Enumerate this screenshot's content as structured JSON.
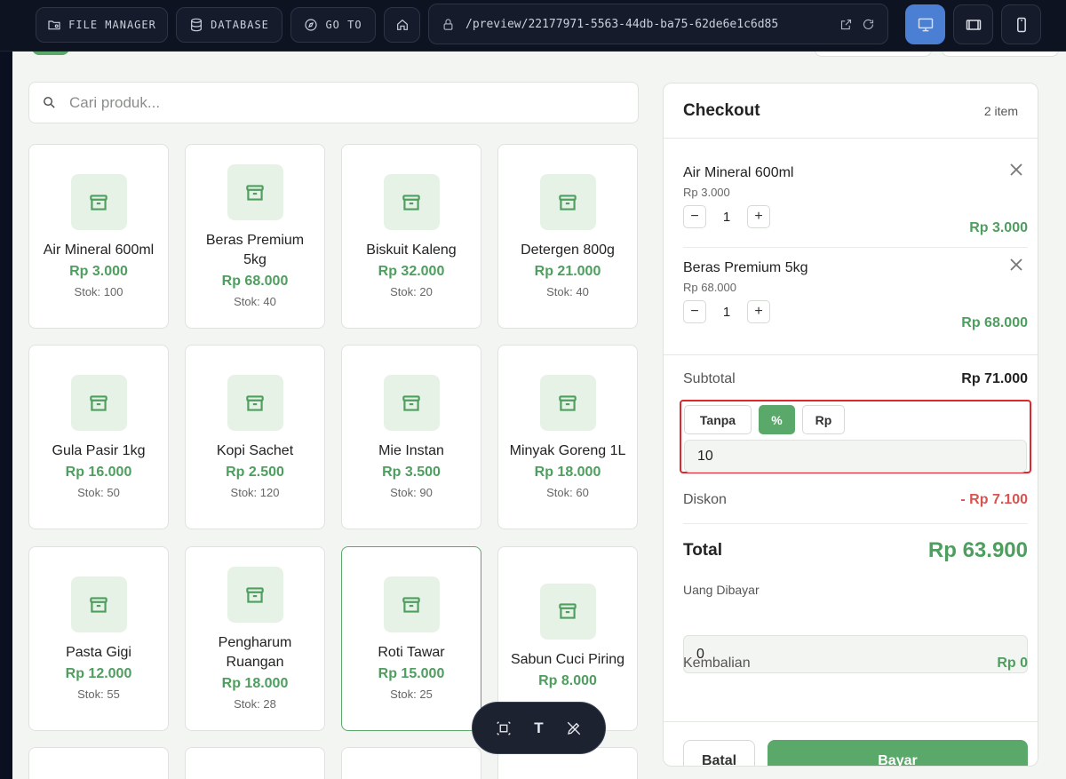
{
  "topbar": {
    "file_manager": "FILE MANAGER",
    "database": "DATABASE",
    "go_to": "GO TO",
    "url": "/preview/22177971-5563-44db-ba75-62de6e1c6d85"
  },
  "search": {
    "placeholder": "Cari produk..."
  },
  "products": [
    {
      "name": "Air Mineral 600ml",
      "price": "Rp 3.000",
      "stock": "Stok: 100"
    },
    {
      "name": "Beras Premium 5kg",
      "price": "Rp 68.000",
      "stock": "Stok: 40"
    },
    {
      "name": "Biskuit Kaleng",
      "price": "Rp 32.000",
      "stock": "Stok: 20"
    },
    {
      "name": "Detergen 800g",
      "price": "Rp 21.000",
      "stock": "Stok: 40"
    },
    {
      "name": "Gula Pasir 1kg",
      "price": "Rp 16.000",
      "stock": "Stok: 50"
    },
    {
      "name": "Kopi Sachet",
      "price": "Rp 2.500",
      "stock": "Stok: 120"
    },
    {
      "name": "Mie Instan",
      "price": "Rp 3.500",
      "stock": "Stok: 90"
    },
    {
      "name": "Minyak Goreng 1L",
      "price": "Rp 18.000",
      "stock": "Stok: 60"
    },
    {
      "name": "Pasta Gigi",
      "price": "Rp 12.000",
      "stock": "Stok: 55"
    },
    {
      "name": "Pengharum Ruangan",
      "price": "Rp 18.000",
      "stock": "Stok: 28"
    },
    {
      "name": "Roti Tawar",
      "price": "Rp 15.000",
      "stock": "Stok: 25"
    },
    {
      "name": "Sabun Cuci Piring",
      "price": "Rp 8.000",
      "stock": ""
    }
  ],
  "checkout": {
    "title": "Checkout",
    "count": "2 item",
    "items": [
      {
        "name": "Air Mineral 600ml",
        "unit_price": "Rp 3.000",
        "qty": "1",
        "total": "Rp 3.000"
      },
      {
        "name": "Beras Premium 5kg",
        "unit_price": "Rp 68.000",
        "qty": "1",
        "total": "Rp 68.000"
      }
    ],
    "subtotal_label": "Subtotal",
    "subtotal_value": "Rp 71.000",
    "discount_modes": [
      "Tanpa",
      "%",
      "Rp"
    ],
    "discount_active": "%",
    "discount_input": "10",
    "discount_label": "Diskon",
    "discount_value": "- Rp 7.100",
    "total_label": "Total",
    "total_value": "Rp 63.900",
    "paid_label": "Uang Dibayar",
    "paid_value": "0",
    "change_label": "Kembalian",
    "change_value": "Rp 0",
    "cancel": "Batal",
    "pay": "Bayar"
  },
  "float_toolbar": {
    "text_tool": "T"
  },
  "colors": {
    "accent": "#5aa96b",
    "danger": "#d9534f",
    "highlight": "#e0272d",
    "device_active": "#4a7fd4"
  }
}
